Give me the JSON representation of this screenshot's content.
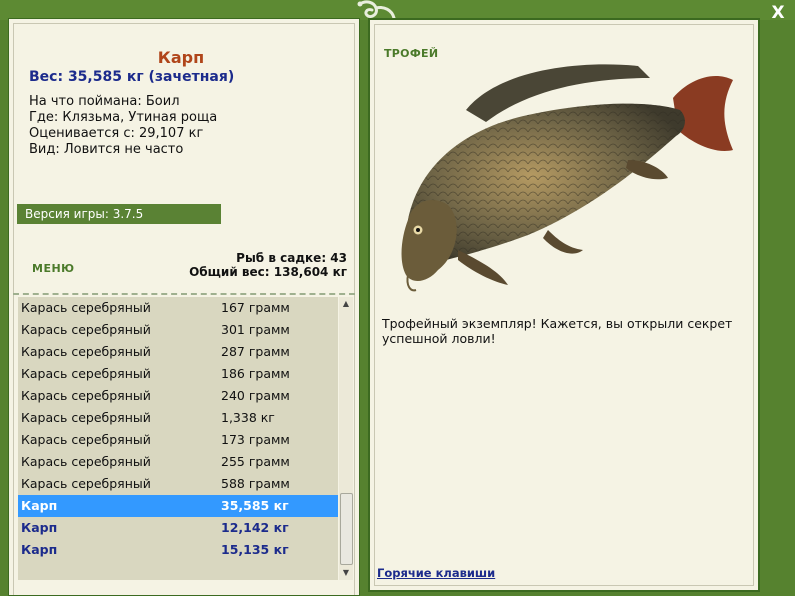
{
  "window": {
    "close_label": "X"
  },
  "fish": {
    "name": "Карп",
    "weight": "Вес: 35,585 кг (зачетная)",
    "bait": "На что поймана: Боил",
    "location": "Где: Клязьма, Утиная роща",
    "value": "Оценивается с: 29,107 кг",
    "species": "Вид: Ловится не часто"
  },
  "version": "Версия игры: 3.7.5",
  "menu": {
    "label": "МЕНЮ"
  },
  "stats": {
    "count": "Рыб в садке: 43",
    "total": "Общий вес: 138,604 кг"
  },
  "catch_list": [
    {
      "name": "Карась серебряный",
      "weight": "167 грамм",
      "style": "normal"
    },
    {
      "name": "Карась серебряный",
      "weight": "301 грамм",
      "style": "normal"
    },
    {
      "name": "Карась серебряный",
      "weight": "287 грамм",
      "style": "normal"
    },
    {
      "name": "Карась серебряный",
      "weight": "186 грамм",
      "style": "normal"
    },
    {
      "name": "Карась серебряный",
      "weight": "240 грамм",
      "style": "normal"
    },
    {
      "name": "Карась серебряный",
      "weight": "1,338 кг",
      "style": "normal"
    },
    {
      "name": "Карась серебряный",
      "weight": "173 грамм",
      "style": "normal"
    },
    {
      "name": "Карась серебряный",
      "weight": "255 грамм",
      "style": "normal"
    },
    {
      "name": "Карась серебряный",
      "weight": "588 грамм",
      "style": "normal"
    },
    {
      "name": "Карп",
      "weight": "35,585 кг",
      "style": "selected"
    },
    {
      "name": "Карп",
      "weight": "12,142 кг",
      "style": "bold"
    },
    {
      "name": "Карп",
      "weight": "15,135 кг",
      "style": "bold"
    }
  ],
  "trophy": {
    "label": "ТРОФЕЙ",
    "description": "Трофейный экземпляр! Кажется, вы открыли секрет успешной ловли!"
  },
  "hotkeys": {
    "label": "Горячие клавиши"
  },
  "colors": {
    "frame": "#56822f",
    "panel": "#f5f3e4",
    "selected": "#3399ff",
    "accent_text": "#1c2b8c",
    "name_text": "#b0451a"
  }
}
